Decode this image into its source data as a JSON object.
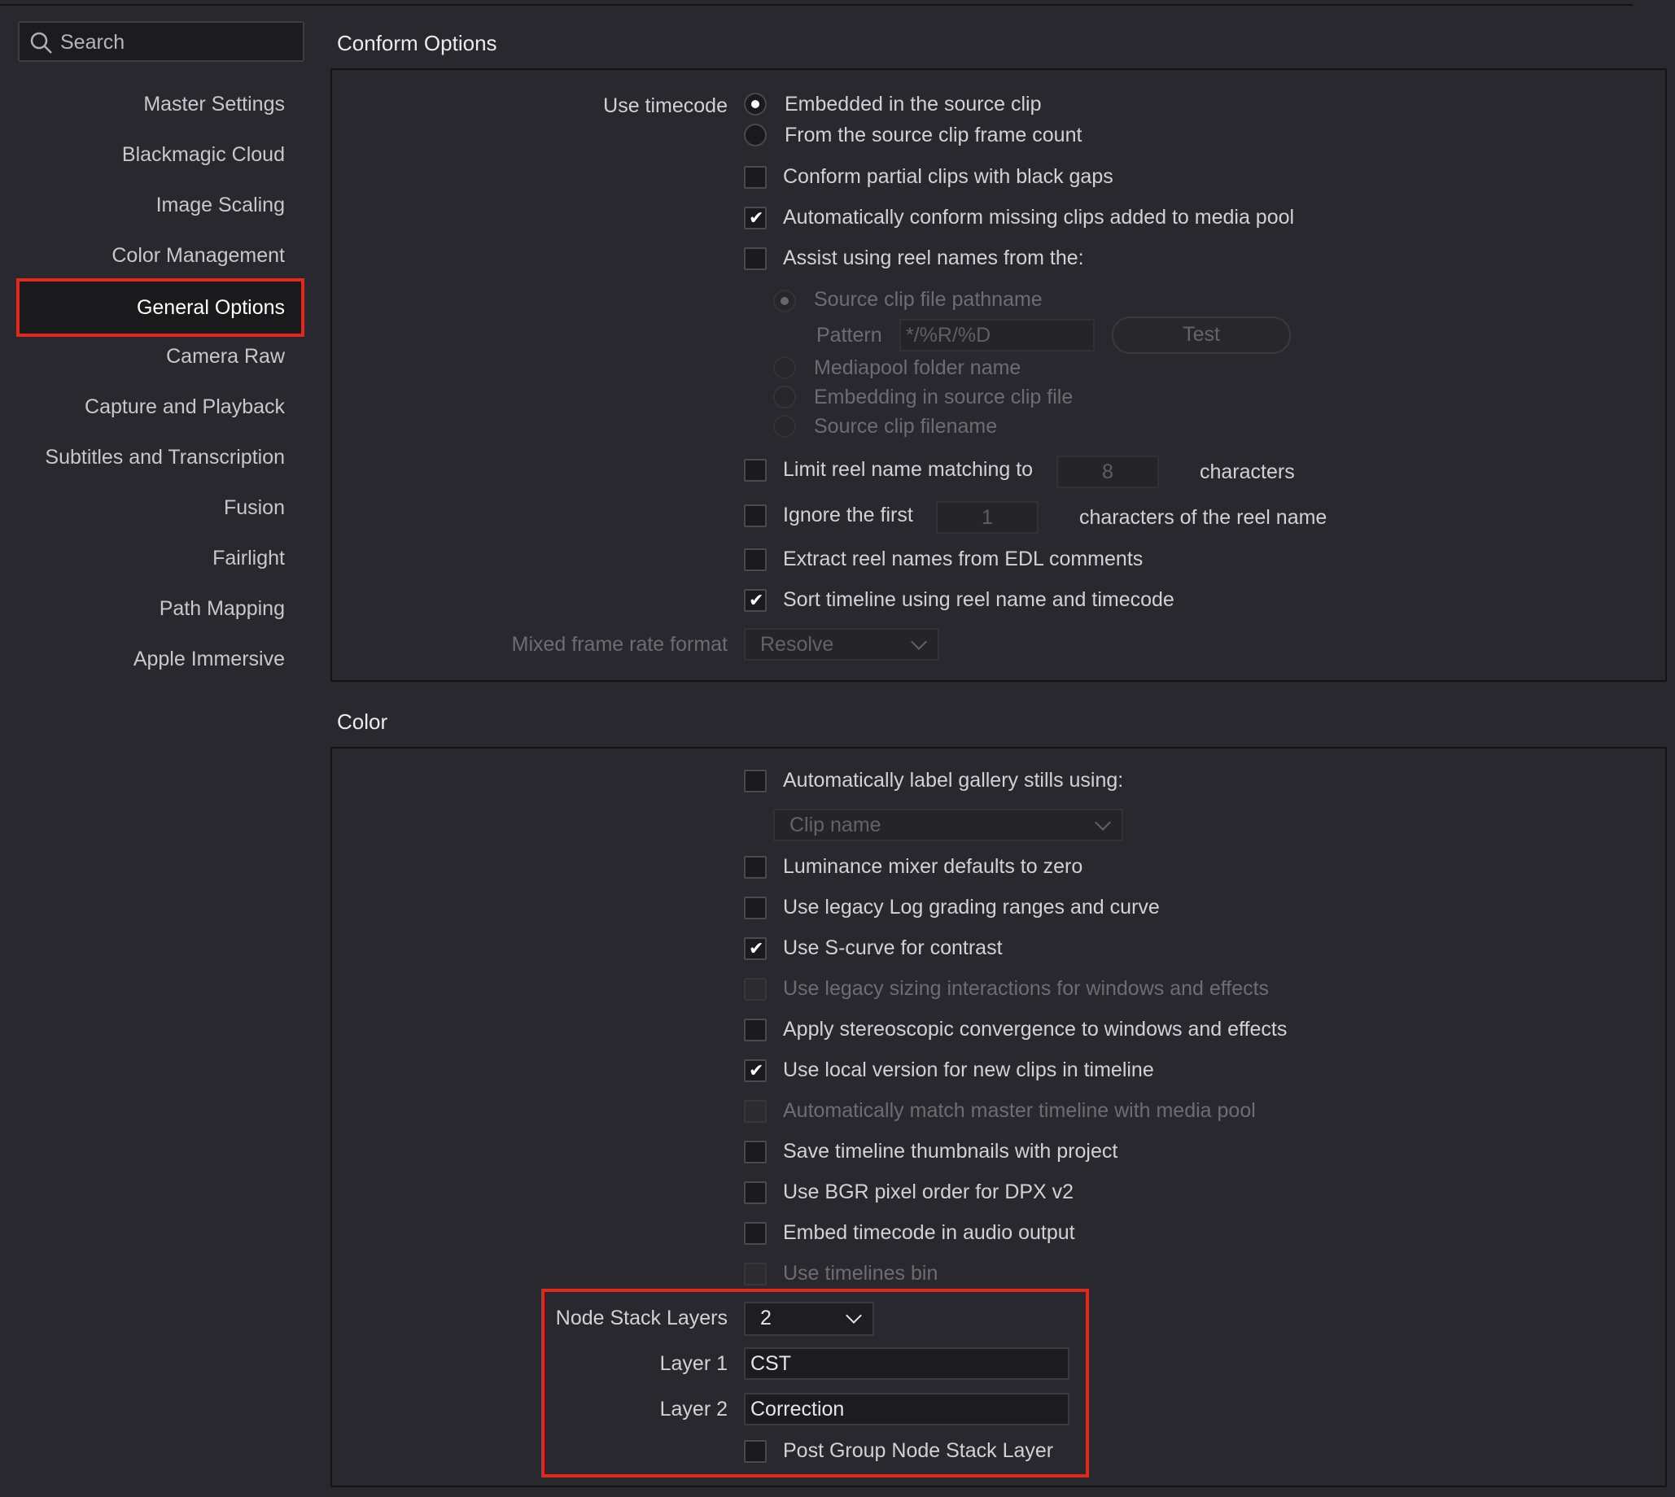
{
  "search": {
    "placeholder": "Search"
  },
  "sidebar": {
    "items": [
      {
        "label": "Master Settings"
      },
      {
        "label": "Blackmagic Cloud"
      },
      {
        "label": "Image Scaling"
      },
      {
        "label": "Color Management"
      },
      {
        "label": "General Options",
        "selected": true
      },
      {
        "label": "Camera Raw"
      },
      {
        "label": "Capture and Playback"
      },
      {
        "label": "Subtitles and Transcription"
      },
      {
        "label": "Fusion"
      },
      {
        "label": "Fairlight"
      },
      {
        "label": "Path Mapping"
      },
      {
        "label": "Apple Immersive"
      }
    ]
  },
  "conform": {
    "title": "Conform Options",
    "use_timecode_label": "Use timecode",
    "tc_embedded": "Embedded in the source clip",
    "tc_framecount": "From the source clip frame count",
    "partial_clips": "Conform partial clips with black gaps",
    "auto_conform": "Automatically conform missing clips added to media pool",
    "assist_reel": "Assist using reel names from the:",
    "source_pathname": "Source clip file pathname",
    "pattern_label": "Pattern",
    "pattern_value": "*/%R/%D",
    "test_button": "Test",
    "mediapool_folder": "Mediapool folder name",
    "embedding_file": "Embedding in source clip file",
    "source_filename": "Source clip filename",
    "limit_reel": "Limit reel name matching to",
    "limit_value": "8",
    "characters": "characters",
    "ignore_first": "Ignore the first",
    "ignore_value": "1",
    "chars_of_reel": "characters of the reel name",
    "extract_edl": "Extract reel names from EDL comments",
    "sort_timeline": "Sort timeline using reel name and timecode",
    "mixed_rate_label": "Mixed frame rate format",
    "mixed_rate_value": "Resolve"
  },
  "color": {
    "title": "Color",
    "auto_label_stills": "Automatically label gallery stills using:",
    "stills_dropdown": "Clip name",
    "luma_mixer": "Luminance mixer defaults to zero",
    "legacy_log": "Use legacy Log grading ranges and curve",
    "s_curve": "Use S-curve for contrast",
    "legacy_sizing": "Use legacy sizing interactions for windows and effects",
    "stereo_conv": "Apply stereoscopic convergence to windows and effects",
    "local_version": "Use local version for new clips in timeline",
    "auto_match": "Automatically match master timeline with media pool",
    "save_thumbs": "Save timeline thumbnails with project",
    "bgr_order": "Use BGR pixel order for DPX v2",
    "embed_tc": "Embed timecode in audio output",
    "timelines_bin": "Use timelines bin",
    "node_stack_label": "Node Stack Layers",
    "node_stack_value": "2",
    "layer1_label": "Layer 1",
    "layer1_value": "CST",
    "layer2_label": "Layer 2",
    "layer2_value": "Correction",
    "post_group": "Post Group Node Stack Layer"
  },
  "colors": {
    "highlight": "#e0291c",
    "background": "#28282e"
  }
}
